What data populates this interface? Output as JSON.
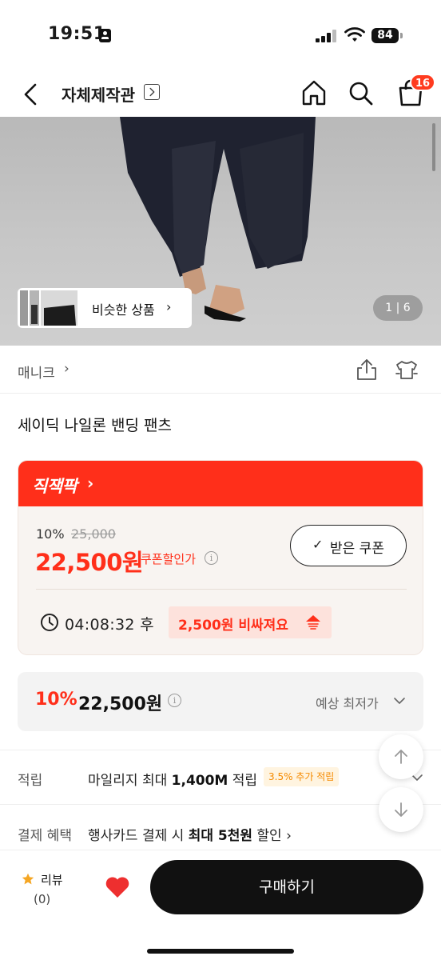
{
  "status_bar": {
    "time": "19:51",
    "battery": "84"
  },
  "nav": {
    "title": "자체제작관",
    "cart_count": "16"
  },
  "gallery": {
    "similar_label": "비슷한 상품",
    "pager": "1 | 6",
    "current_page": 1,
    "total_pages": 6
  },
  "brand": {
    "name": "매니크"
  },
  "product": {
    "title": "세이딕 나일론 밴딩 팬츠"
  },
  "deal": {
    "header": "직잭팍",
    "discount_rate": "10%",
    "original_price": "25,000",
    "sale_price": "22,500원",
    "coupon_label": "쿠폰할인가",
    "coupon_button": "받은 쿠폰",
    "countdown": "04:08:32 후",
    "price_up_text": "2,500원 비싸져요"
  },
  "lowest": {
    "rate": "10%",
    "price": "22,500원",
    "label": "예상 최저가"
  },
  "points": {
    "label": "적립",
    "prefix": "마일리지 최대 ",
    "amount": "1,400M",
    "suffix": " 적립",
    "bonus": "3.5% 추가 적립"
  },
  "payment": {
    "label": "결제 혜택",
    "prefix": "행사카드 결제 시 ",
    "highlight": "최대 5천원",
    "suffix": " 할인"
  },
  "bottom": {
    "review_label": "리뷰",
    "review_count": "(0)",
    "buy_label": "구매하기"
  },
  "colors": {
    "accent": "#ff2f1a",
    "buy_button": "#111111",
    "bonus_text": "#f58a00"
  },
  "icons": {
    "back": "chevron-left-icon",
    "home": "home-icon",
    "search": "search-icon",
    "cart": "shopping-bag-icon",
    "share": "share-icon",
    "compare": "shirt-compare-icon",
    "clock": "clock-icon",
    "price_up": "rising-arrow-icon",
    "star": "star-icon",
    "heart": "heart-icon"
  }
}
